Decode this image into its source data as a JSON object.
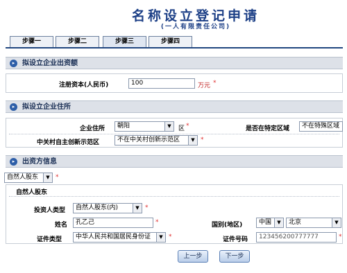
{
  "header": {
    "title": "名称设立登记申请",
    "subtitle": "(一人有限责任公司)"
  },
  "tabs": [
    "步骤一",
    "步骤二",
    "步骤三",
    "步骤四"
  ],
  "sections": {
    "capital": "拟设立企业出资额",
    "address": "拟设立企业住所",
    "investor": "出资方信息"
  },
  "capital": {
    "label": "注册资本(人民币)",
    "value": "100",
    "unit": "万元"
  },
  "address": {
    "location_label": "企业住所",
    "location_value": "朝阳",
    "location_suffix": "区",
    "special_label": "是否在特定区域",
    "special_value": "不在特殊区域",
    "zgc_label": "中关村自主创新示范区",
    "zgc_value": "不在中关村创新示范区"
  },
  "investor": {
    "type_select": "自然人股东",
    "group_title": "自然人股东",
    "investor_type_label": "投资人类型",
    "investor_type_value": "自然人股东(内)",
    "name_label": "姓名",
    "name_value": "孔乙己",
    "country_label": "国别(地区)",
    "country_value": "中国",
    "region_value": "北京",
    "id_type_label": "证件类型",
    "id_type_value": "中华人民共和国居民身份证",
    "id_no_label": "证件号码",
    "id_no_value": "123456200777777"
  },
  "required_mark": "*",
  "buttons": {
    "prev": "上一步",
    "next": "下一步"
  },
  "colors": {
    "title": "#1c3f86",
    "section_bg": "#dde1e8",
    "required": "#e03030"
  }
}
